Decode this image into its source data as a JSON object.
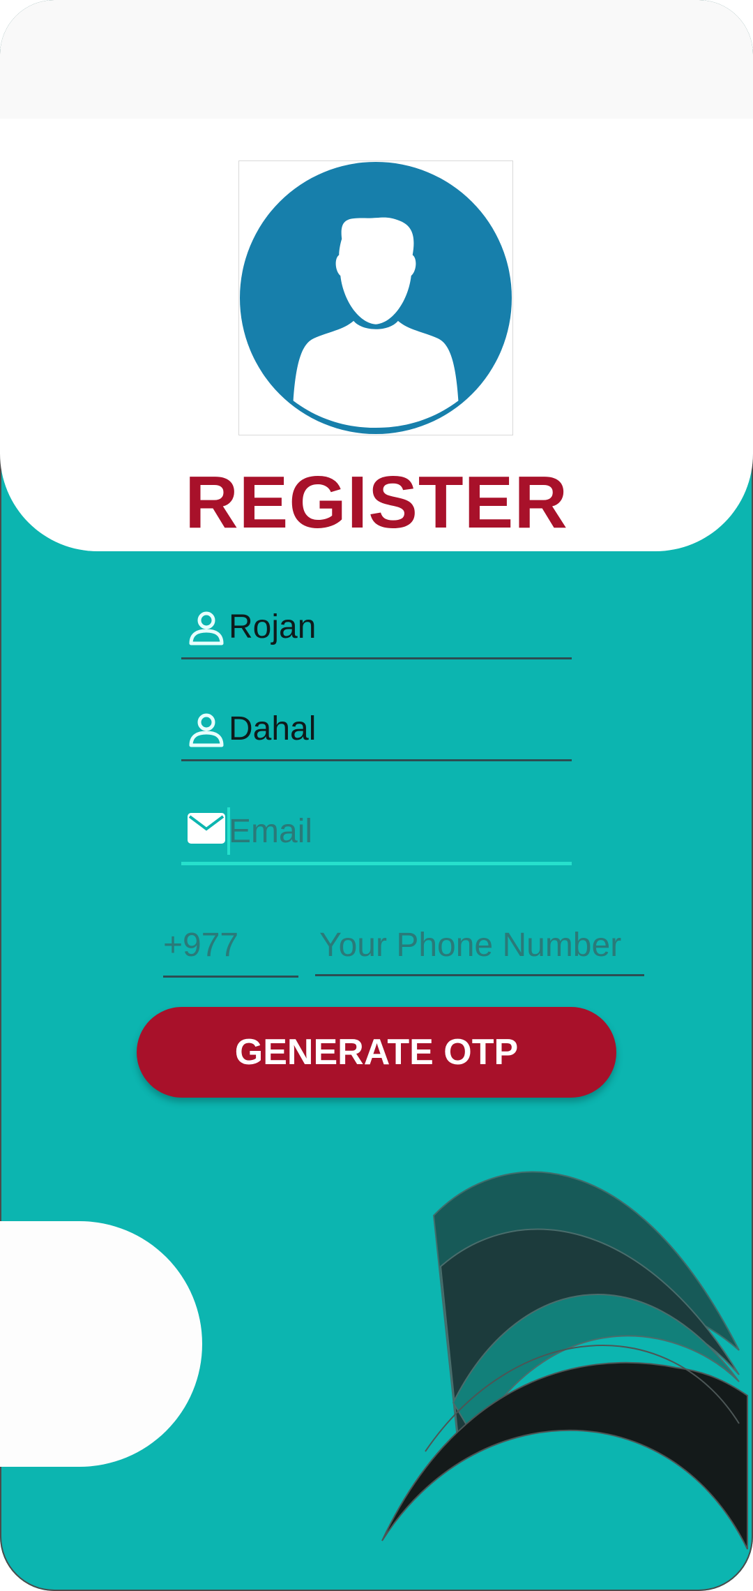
{
  "form": {
    "title": "REGISTER",
    "first_name": {
      "value": "Rojan",
      "icon": "person-icon"
    },
    "last_name": {
      "value": "Dahal",
      "icon": "person-icon"
    },
    "email": {
      "value": "",
      "placeholder": "Email",
      "icon": "mail-icon"
    },
    "phone": {
      "country_code": "+977",
      "placeholder": "Your Phone Number"
    },
    "submit_label": "GENERATE OTP"
  },
  "colors": {
    "background": "#0cb5b0",
    "accent": "#a8112a",
    "focus_underline": "#26e0cc",
    "avatar": "#177fab"
  }
}
